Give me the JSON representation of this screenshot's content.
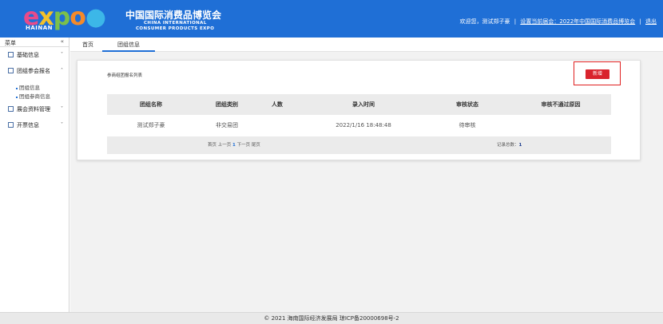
{
  "header": {
    "logo_text": "expo",
    "logo_sub": "HAINAN",
    "title_cn": "中国国际消费品博览会",
    "title_en_line1": "CHINA INTERNATIONAL",
    "title_en_line2": "CONSUMER PRODUCTS EXPO",
    "welcome": "欢迎您，测试郑子豪",
    "set_current_expo": "设置当前届会：2022年中国国际消费品博览会",
    "logout": "退出",
    "separator": "|",
    "bg_color": "#1f6fd6"
  },
  "sidebar": {
    "title": "菜单",
    "collapse": "«",
    "items": [
      {
        "label": "基础信息",
        "icon": "info-icon",
        "caret": "˅"
      },
      {
        "label": "团组参会报名",
        "icon": "form-icon",
        "caret": "˄"
      },
      {
        "label": "展会资料管理",
        "icon": "file-icon",
        "caret": "˅"
      },
      {
        "label": "开票信息",
        "icon": "invoice-icon",
        "caret": "˅"
      }
    ],
    "sub_items": [
      "团组信息",
      "团组参商信息"
    ]
  },
  "tabs": {
    "home": "首页",
    "active": "团组信息"
  },
  "panel": {
    "title": "参商组团报名列表",
    "add_button": "新增",
    "table": {
      "headers": [
        "团组名称",
        "团组类别",
        "人数",
        "录入时间",
        "审核状态",
        "审核不通过原因"
      ],
      "rows": [
        [
          "测试郑子豪",
          "非交易团",
          "",
          "2022/1/16 18:48:48",
          "待审核",
          ""
        ]
      ],
      "pager": {
        "first": "首页",
        "prev": "上一页",
        "current": "1",
        "next": "下一页",
        "last": "尾页"
      },
      "total_label": "记录总数：",
      "total_value": "1"
    }
  },
  "footer": {
    "text": "© 2021 海南国际经济发展局 琼ICP备20000698号-2"
  },
  "colors": {
    "accent": "#1f6fd6",
    "add_button": "#d9232d",
    "highlight_border": "#e02020"
  }
}
